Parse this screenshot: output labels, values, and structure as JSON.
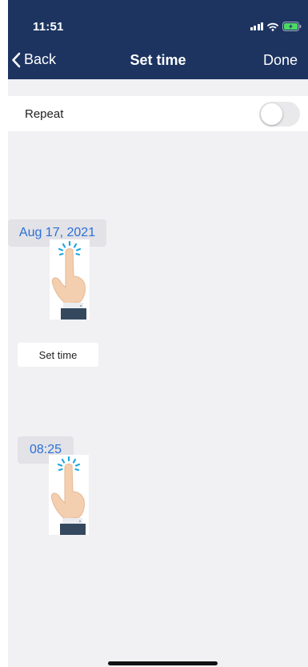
{
  "status_bar": {
    "time": "11:51"
  },
  "nav": {
    "back_label": "Back",
    "title": "Set time",
    "done_label": "Done"
  },
  "repeat": {
    "label": "Repeat",
    "enabled": false
  },
  "date_chip": {
    "value": "Aug 17, 2021"
  },
  "set_time_button": {
    "label": "Set time"
  },
  "time_chip": {
    "value": "08:25"
  },
  "colors": {
    "header": "#1d3461",
    "background": "#f1f0f3",
    "accent": "#2b6fd6",
    "chip": "#e2e2e7"
  },
  "icons": [
    "signal-icon",
    "wifi-icon",
    "battery-icon",
    "chevron-left-icon",
    "tap-hand-icon"
  ]
}
